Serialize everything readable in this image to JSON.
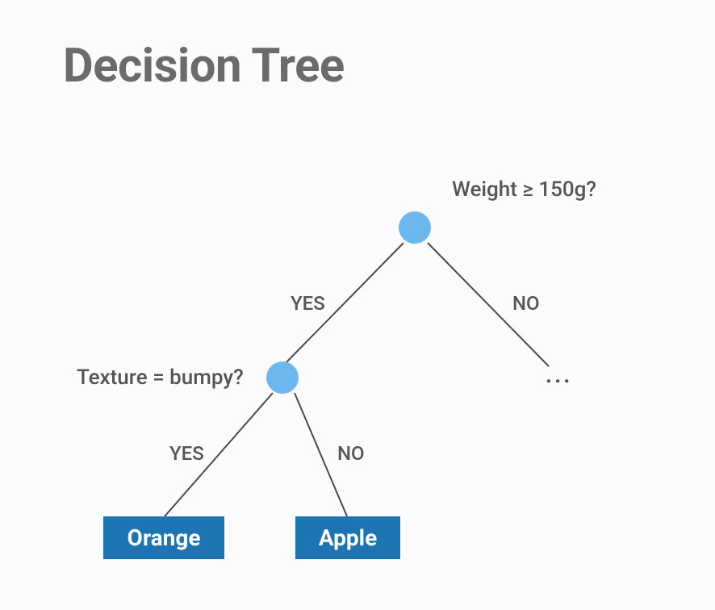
{
  "title": "Decision Tree",
  "root": {
    "question": "Weight ≥ 150g?",
    "yes_label": "YES",
    "no_label": "NO"
  },
  "left_child": {
    "question": "Texture = bumpy?",
    "yes_label": "YES",
    "no_label": "NO"
  },
  "right_child": {
    "placeholder": "..."
  },
  "leaves": {
    "orange": "Orange",
    "apple": "Apple"
  }
}
